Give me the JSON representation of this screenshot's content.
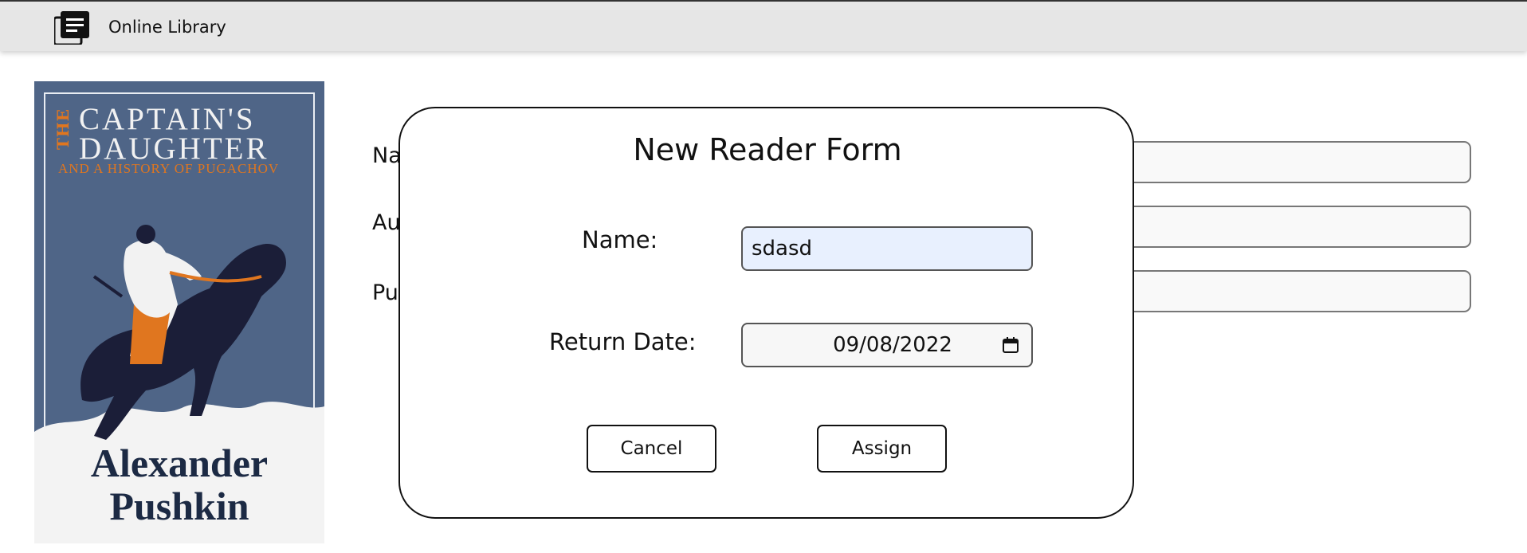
{
  "header": {
    "brand": "Online Library"
  },
  "book": {
    "cover": {
      "title_prefix": "THE",
      "title_line1": "CAPTAIN'S",
      "title_line2": "DAUGHTER",
      "subtitle": "AND A HISTORY OF PUGACHOV",
      "author_line1": "Alexander",
      "author_line2": "Pushkin"
    },
    "fields": [
      {
        "label": "Na"
      },
      {
        "label": "Au"
      },
      {
        "label": "Pu"
      }
    ]
  },
  "modal": {
    "title": "New Reader Form",
    "name_label": "Name:",
    "name_value": "sdasd",
    "return_date_label": "Return Date:",
    "return_date_value": "09/08/2022",
    "cancel_label": "Cancel",
    "assign_label": "Assign"
  }
}
